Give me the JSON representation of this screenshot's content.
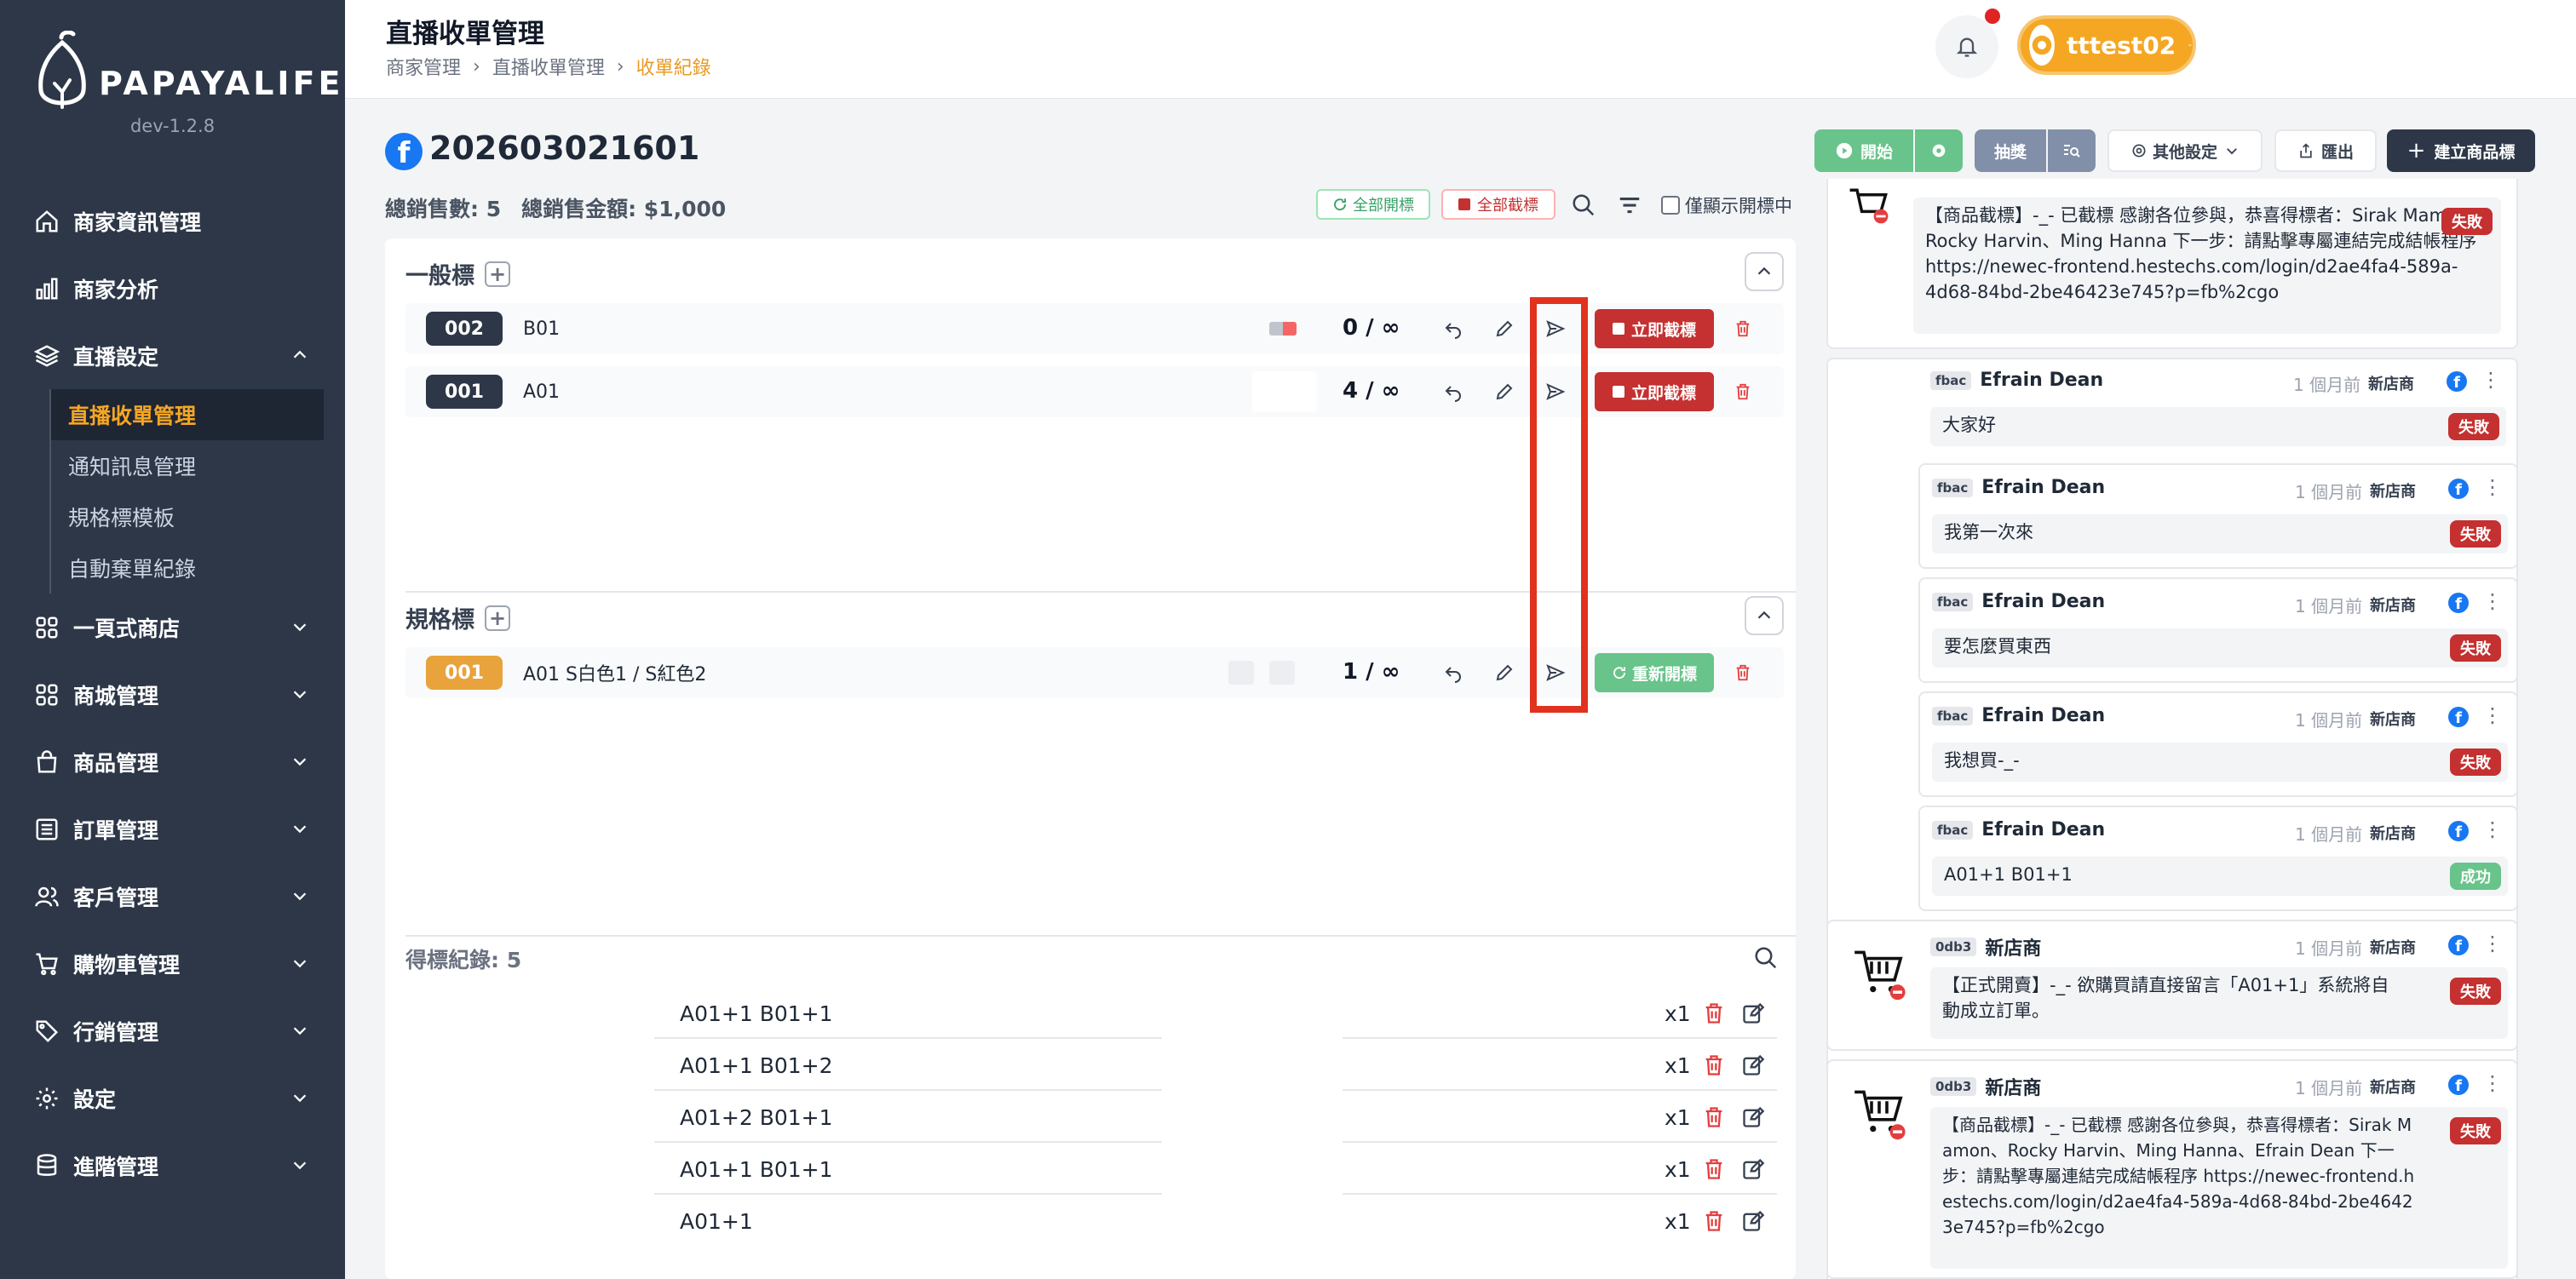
{
  "brand": {
    "name": "PAPAYALIFE",
    "version": "dev-1.2.8"
  },
  "sidebar": {
    "items": [
      {
        "label": "商家資訊管理"
      },
      {
        "label": "商家分析"
      },
      {
        "label": "直播設定"
      },
      {
        "label": "一頁式商店"
      },
      {
        "label": "商城管理"
      },
      {
        "label": "商品管理"
      },
      {
        "label": "訂單管理"
      },
      {
        "label": "客戶管理"
      },
      {
        "label": "購物車管理"
      },
      {
        "label": "行銷管理"
      },
      {
        "label": "設定"
      },
      {
        "label": "進階管理"
      }
    ],
    "sub_items": [
      {
        "label": "直播收單管理"
      },
      {
        "label": "通知訊息管理"
      },
      {
        "label": "規格標模板"
      },
      {
        "label": "自動棄單紀錄"
      }
    ]
  },
  "header": {
    "title": "直播收單管理",
    "breadcrumb": [
      "商家管理",
      "直播收單管理",
      "收單紀錄"
    ],
    "user": "tttest02"
  },
  "toolbar": {
    "start": "開始",
    "lottery": "抽獎",
    "other_settings": "其他設定",
    "export": "匯出",
    "create_product": "建立商品標"
  },
  "stream": {
    "id": "202603021601",
    "total_sales_label": "總銷售數: 5",
    "total_amount_label": "總銷售金額: $1,000",
    "open_all": "全部開標",
    "close_all": "全部截標",
    "only_open_label": "僅顯示開標中"
  },
  "general": {
    "title": "一般標",
    "rows": [
      {
        "code": "002",
        "name": "B01",
        "count": "0 / ∞",
        "action": "立即截標"
      },
      {
        "code": "001",
        "name": "A01",
        "count": "4 / ∞",
        "action": "立即截標"
      }
    ]
  },
  "spec": {
    "title": "規格標",
    "rows": [
      {
        "code": "001",
        "name": "A01  S白色1 / S紅色2",
        "count": "1 / ∞",
        "action": "重新開標"
      }
    ]
  },
  "history": {
    "title": "得標紀錄: 5",
    "rows": [
      {
        "text": "A01+1 B01+1",
        "qty": "x1"
      },
      {
        "text": "A01+1 B01+2",
        "qty": "x1"
      },
      {
        "text": "A01+2 B01+1",
        "qty": "x1"
      },
      {
        "text": "A01+1 B01+1",
        "qty": "x1"
      },
      {
        "text": "A01+1",
        "qty": "x1"
      }
    ]
  },
  "chat": {
    "top_message": {
      "text": "【商品截標】-_- 已截標 感謝各位參與，恭喜得標者：Sirak Mamon、Rocky Harvin、Ming Hanna 下一步：請點擊專屬連結完成結帳程序 https://newec-frontend.hestechs.com/login/d2ae4fa4-589a-4d68-84bd-2be46423e745?p=fb%2cgo",
      "status": "失敗"
    },
    "replies": [
      {
        "tag": "fbac",
        "name": "Efrain Dean",
        "time": "1 個月前",
        "shop": "新店商",
        "text": "大家好",
        "status": "失敗"
      },
      {
        "tag": "fbac",
        "name": "Efrain Dean",
        "time": "1 個月前",
        "shop": "新店商",
        "text": "我第一次來",
        "status": "失敗"
      },
      {
        "tag": "fbac",
        "name": "Efrain Dean",
        "time": "1 個月前",
        "shop": "新店商",
        "text": "要怎麼買東西",
        "status": "失敗"
      },
      {
        "tag": "fbac",
        "name": "Efrain Dean",
        "time": "1 個月前",
        "shop": "新店商",
        "text": "我想買-_-",
        "status": "失敗"
      },
      {
        "tag": "fbac",
        "name": "Efrain Dean",
        "time": "1 個月前",
        "shop": "新店商",
        "text": "A01+1 B01+1",
        "status": "成功"
      }
    ],
    "system": [
      {
        "tag": "0db3",
        "name": "新店商",
        "time": "1 個月前",
        "shop": "新店商",
        "text": "【正式開賣】-_- 欲購買請直接留言「A01+1」系統將自動成立訂單。",
        "status": "失敗"
      },
      {
        "tag": "0db3",
        "name": "新店商",
        "time": "1 個月前",
        "shop": "新店商",
        "text": "【商品截標】-_- 已截標 感謝各位參與，恭喜得標者：Sirak Mamon、Rocky Harvin、Ming Hanna、Efrain Dean 下一步：請點擊專屬連結完成結帳程序 https://newec-frontend.hestechs.com/login/d2ae4fa4-589a-4d68-84bd-2be46423e745?p=fb%2cgo",
        "status": "失敗"
      }
    ]
  },
  "colors": {
    "sidebar": "#2d3748",
    "accent": "#f5a623",
    "danger": "#c53030",
    "success": "#68c48a",
    "highlight": "#e0321f"
  }
}
